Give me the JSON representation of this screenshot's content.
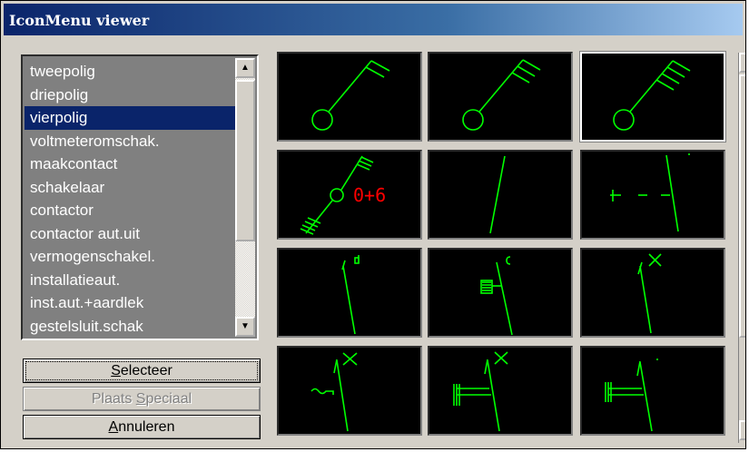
{
  "window": {
    "title": "IconMenu viewer"
  },
  "list": {
    "items": [
      "tweepolig",
      "driepolig",
      "vierpolig",
      "voltmeteromschak.",
      "maakcontact",
      "schakelaar",
      "contactor",
      "contactor aut.uit",
      "vermogenschakel.",
      "installatieaut.",
      "inst.aut.+aardlek",
      "gestelsluit.schak"
    ],
    "selected": "vierpolig"
  },
  "buttons": {
    "select": {
      "pre": "",
      "key": "S",
      "post": "electeer"
    },
    "place_special": {
      "pre": "Plaats ",
      "key": "S",
      "post": "peciaal"
    },
    "cancel": {
      "pre": "",
      "key": "A",
      "post": "nnuleren"
    }
  },
  "icons": {
    "cell_4_text": "0+6",
    "colors": {
      "symbol": "#00ff00",
      "text": "#ff0000",
      "background": "#000000"
    },
    "names": [
      "tweepolig-symbol",
      "driepolig-symbol",
      "vierpolig-symbol",
      "voltmeteromschak-symbol",
      "maakcontact-symbol",
      "schakelaar-symbol",
      "contactor-symbol",
      "contactor-aut-uit-symbol",
      "vermogenschakel-symbol",
      "installatieaut-symbol",
      "inst-aut-aardlek-symbol",
      "gestelsluit-schak-symbol"
    ],
    "selected_index": 2
  }
}
